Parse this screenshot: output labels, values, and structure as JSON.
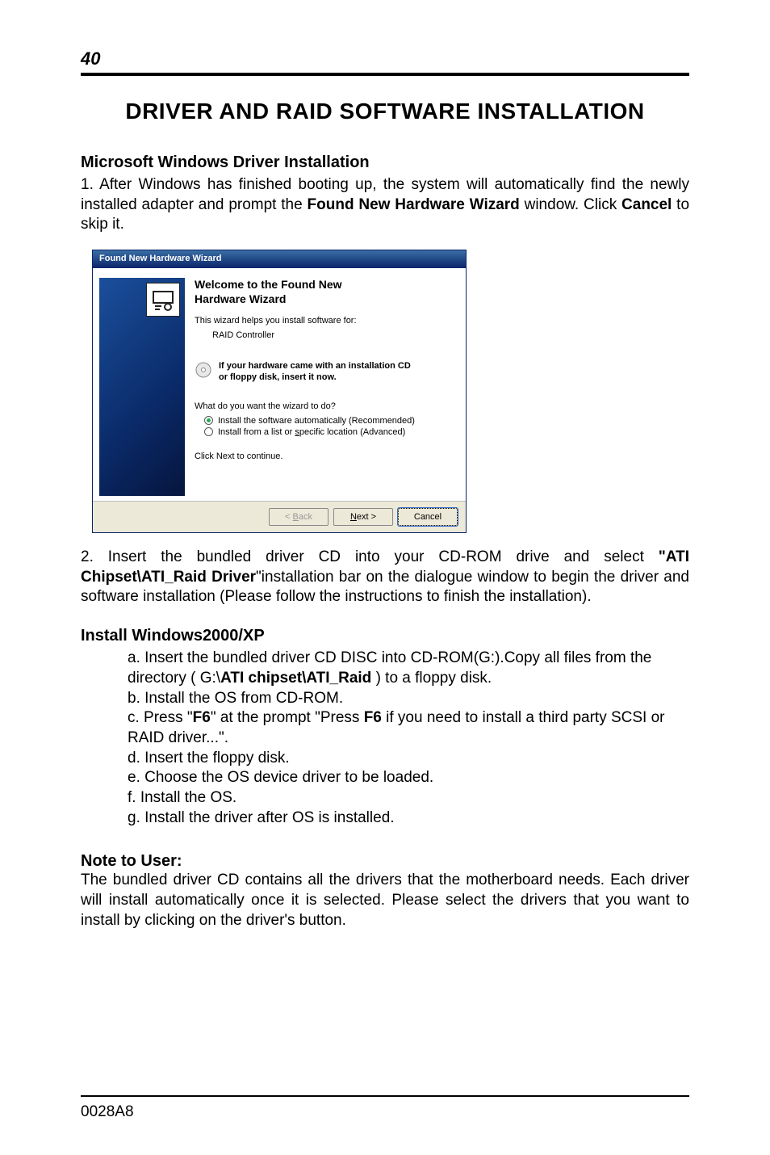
{
  "page_number": "40",
  "main_title": "DRIVER AND RAID SOFTWARE INSTALLATION",
  "section1_heading": "Microsoft Windows Driver Installation",
  "para1_a": "1. After Windows has finished booting up, the system will automatically find the newly installed adapter and prompt the ",
  "para1_bold": "Found New Hardware  Wizard",
  "para1_b": " window. Click ",
  "para1_bold2": "Cancel",
  "para1_c": " to skip it.",
  "wizard": {
    "title": "Found New Hardware Wizard",
    "welcome_l1": "Welcome to the Found New",
    "welcome_l2": "Hardware Wizard",
    "helps": "This wizard helps you install software for:",
    "device": "RAID Controller",
    "cd_l1": "If your hardware came with an installation CD",
    "cd_l2": "or floppy disk, insert it now.",
    "question": "What do you want the wizard to do?",
    "opt1_pre": "Install the software automatically (Recommended)",
    "opt2_pre": "Install from a list or ",
    "opt2_key": "s",
    "opt2_post": "pecific location (Advanced)",
    "continue": "Click Next to continue.",
    "back_pre": "< ",
    "back_key": "B",
    "back_post": "ack",
    "next_key": "N",
    "next_post": "ext >",
    "cancel": "Cancel"
  },
  "para2_a": "2. Insert the bundled driver CD into your CD-ROM drive and select ",
  "para2_bold1": "\"ATI Chipset\\ATI_Raid Driver",
  "para2_b": "\"installation bar on the dialogue window to begin the driver and software installation (Please follow the instructions to finish the installation).",
  "section2_heading": "Install Windows2000/XP",
  "steps": {
    "a_pre": "a. Insert the bundled driver CD DISC into CD-ROM(G:).Copy all files from the directory ( G:\\",
    "a_bold": "ATI chipset\\ATI_Raid",
    "a_post": " ) to a floppy disk.",
    "b": "b. Install the OS from CD-ROM.",
    "c_pre": "c. Press \"",
    "c_bold1": "F6",
    "c_mid": "\" at the prompt \"Press ",
    "c_bold2": "F6",
    "c_post": " if you need to install a third party SCSI or RAID driver...\".",
    "d": "d. Insert the floppy disk.",
    "e": "e. Choose the OS device driver to be loaded.",
    "f": "f. Install the OS.",
    "g": "g. Install the driver after OS is installed."
  },
  "note_heading": "Note to User:",
  "note_body": "The bundled driver CD contains all the drivers that the motherboard needs. Each driver will install automatically once it is selected. Please select the drivers  that  you  want to install by clicking on the driver's button.",
  "footer_code": "0028A8"
}
